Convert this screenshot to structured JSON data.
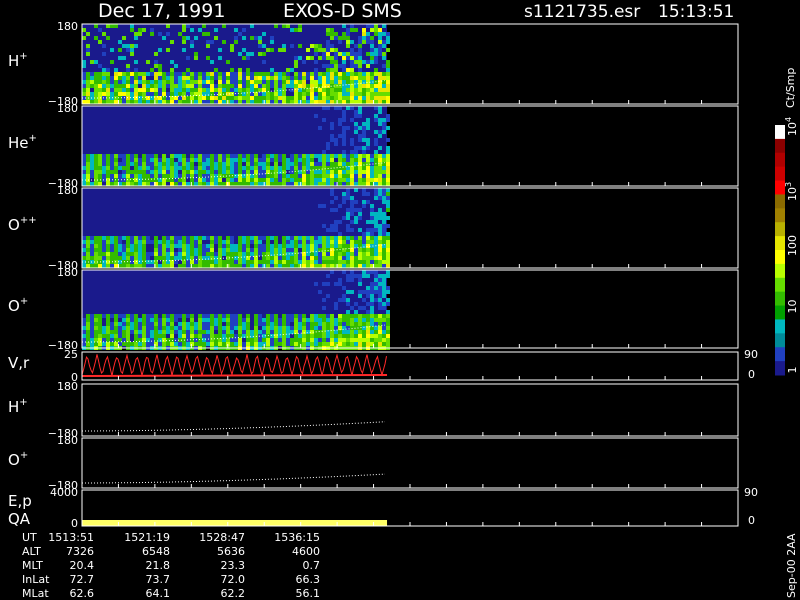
{
  "header": {
    "date": "Dec 17, 1991",
    "mission": "EXOS-D SMS",
    "file": "s1121735.esr",
    "time": "15:13:51"
  },
  "colors": {
    "background": "#000000",
    "axes": "#ffffff",
    "data_fill": "#ffff66",
    "vr_trace": "#ff2a2a",
    "spectro_low": "#1a1a8c",
    "spectro_mid": "#00b7c0",
    "spectro_green": "#33cc33",
    "spectro_yellow": "#ffff00",
    "spectro_high": "#cc0000"
  },
  "panels": [
    {
      "label": "H",
      "sup": "+",
      "ymax": "180",
      "ymin": "−180",
      "kind": "spectrogram",
      "seed": 1
    },
    {
      "label": "He",
      "sup": "+",
      "ymax": "180",
      "ymin": "−180",
      "kind": "spectrogram",
      "seed": 2
    },
    {
      "label": "O",
      "sup": "++",
      "ymax": "180",
      "ymin": "−180",
      "kind": "spectrogram",
      "seed": 3
    },
    {
      "label": "O",
      "sup": "+",
      "ymax": "180",
      "ymin": "−180",
      "kind": "spectrogram",
      "seed": 4
    },
    {
      "label": "V,r",
      "sup": "",
      "ymax": "25",
      "ymin": "0",
      "right_max": "90",
      "right_min": "0",
      "kind": "vr"
    },
    {
      "label": "H",
      "sup": "+",
      "ymax": "180",
      "ymin": "−180",
      "kind": "line"
    },
    {
      "label": "O",
      "sup": "+",
      "ymax": "180",
      "ymin": "−180",
      "kind": "line"
    },
    {
      "label": "E,p",
      "sup": "",
      "label2": "QA",
      "ymax": "4000",
      "ymin": "0",
      "right_max": "90",
      "right_min": "0",
      "kind": "qa"
    }
  ],
  "colorbar": {
    "unit": "Ct/Smp",
    "ticks": [
      {
        "base": "10",
        "exp": "4",
        "pos": 0.02
      },
      {
        "base": "10",
        "exp": "3",
        "pos": 0.28
      },
      {
        "base": "100",
        "exp": "",
        "pos": 0.5
      },
      {
        "base": "10",
        "exp": "",
        "pos": 0.73
      },
      {
        "base": "1",
        "exp": "",
        "pos": 0.97
      }
    ],
    "colors": [
      "#ffffff",
      "#8b0000",
      "#b00000",
      "#cc0000",
      "#ff0000",
      "#8b6b00",
      "#a08000",
      "#b8b000",
      "#e6e600",
      "#ffff00",
      "#b8ff00",
      "#66dd00",
      "#33bb00",
      "#00a000",
      "#00b7c0",
      "#008b9a",
      "#2040c0",
      "#1a1a8c"
    ]
  },
  "chart_data": {
    "type": "heatmap",
    "title": "Dec 17, 1991   EXOS-D SMS",
    "x_labels": [
      "1513:51",
      "1521:19",
      "1528:47",
      "1536:15"
    ],
    "data_end_fraction": 0.465,
    "ephemeris": [
      {
        "name": "UT",
        "values": [
          "1513:51",
          "1521:19",
          "1528:47",
          "1536:15"
        ]
      },
      {
        "name": "ALT",
        "values": [
          "7326",
          "6548",
          "5636",
          "4600"
        ]
      },
      {
        "name": "MLT",
        "values": [
          "20.4",
          "21.8",
          "23.3",
          "0.7"
        ]
      },
      {
        "name": "InLat",
        "values": [
          "72.7",
          "73.7",
          "72.0",
          "66.3"
        ]
      },
      {
        "name": "MLat",
        "values": [
          "62.6",
          "64.1",
          "62.2",
          "56.1"
        ]
      }
    ]
  },
  "footer": {
    "stamp": "Sep-00 2AA"
  }
}
